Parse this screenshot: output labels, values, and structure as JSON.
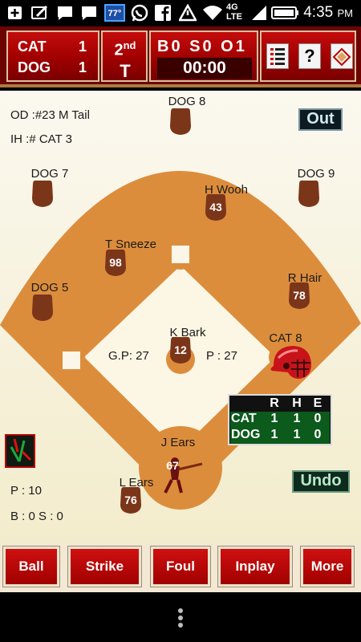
{
  "status_bar": {
    "temperature": "77°",
    "network": "4G LTE",
    "time": "4:35",
    "ampm": "PM",
    "icons": [
      "add-box-icon",
      "edit-icon",
      "chat-bubble-icon",
      "chat-bubble-icon",
      "weather-icon",
      "whatsapp-icon",
      "facebook-icon",
      "warning-icon",
      "wifi-icon",
      "signal-icon",
      "battery-icon"
    ]
  },
  "scoreboard": {
    "teams": [
      {
        "name": "CAT",
        "score": "1"
      },
      {
        "name": "DOG",
        "score": "1"
      }
    ],
    "inning": "2",
    "inning_suffix": "nd",
    "half": "T",
    "count": "B0 S0 O1",
    "timer": "00:00"
  },
  "info": {
    "offense_defense": "OD :#23 M Tail",
    "in_hole": "IH  :# CAT 3",
    "pitch_count": "P : 10",
    "balls_strikes": "B : 0 S : 0"
  },
  "labels": {
    "out": "Out",
    "undo": "Undo",
    "gp": "G.P: 27",
    "p": "P : 27"
  },
  "fielders": [
    {
      "name": "DOG 8",
      "number": ""
    },
    {
      "name": "DOG 7",
      "number": ""
    },
    {
      "name": "DOG 9",
      "number": ""
    },
    {
      "name": "H Wooh",
      "number": "43"
    },
    {
      "name": "T Sneeze",
      "number": "98"
    },
    {
      "name": "R Hair",
      "number": "78"
    },
    {
      "name": "DOG 5",
      "number": ""
    },
    {
      "name": "K Bark",
      "number": "12"
    },
    {
      "name": "L Ears",
      "number": "76"
    }
  ],
  "catcher": {
    "name": "CAT 8"
  },
  "batter": {
    "name": "J Ears",
    "number": "67"
  },
  "line_score": {
    "headers": [
      "R",
      "H",
      "E"
    ],
    "rows": [
      {
        "team": "CAT",
        "r": "1",
        "h": "1",
        "e": "0"
      },
      {
        "team": "DOG",
        "r": "1",
        "h": "1",
        "e": "0"
      }
    ]
  },
  "actions": [
    "Ball",
    "Strike",
    "Foul",
    "Inplay",
    "More"
  ],
  "colors": {
    "dirt": "#dc8d3c",
    "grass": "#fdf8e6",
    "glove": "#7b3519",
    "scoreboard_red": "#b00000",
    "line_score_green": "#0c5a1c"
  }
}
